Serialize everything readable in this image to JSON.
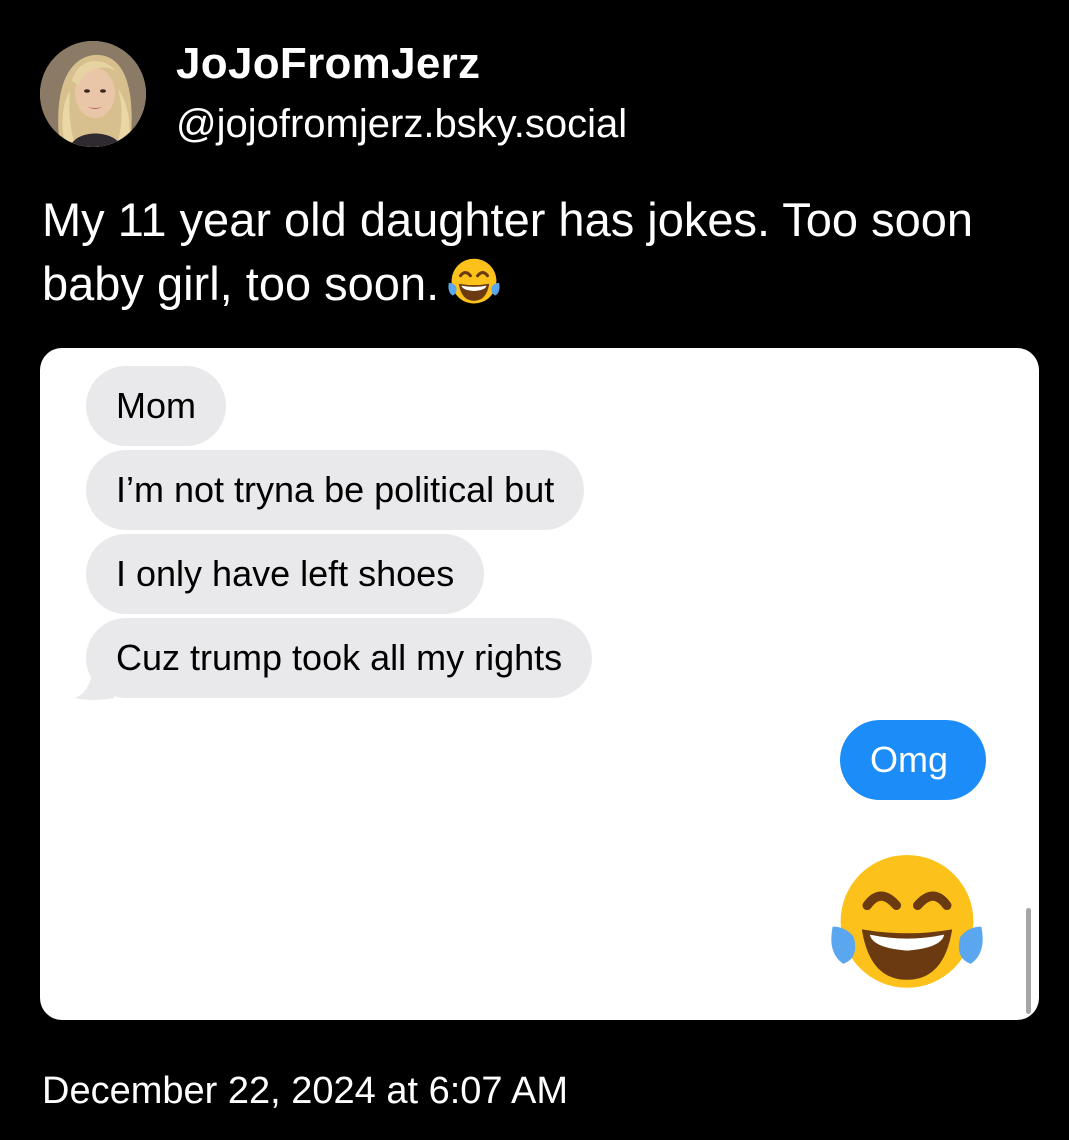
{
  "author": {
    "display_name": "JoJoFromJerz",
    "handle": "@jojofromjerz.bsky.social"
  },
  "post": {
    "text": "My 11 year old daughter has jokes. Too soon baby girl, too soon.",
    "text_emoji": "face-with-tears-of-joy-icon",
    "timestamp": "December 22, 2024 at 6:07 AM"
  },
  "attached_screenshot": {
    "received_messages": [
      "Mom",
      "I’m not tryna be political but",
      "I only have left shoes",
      "Cuz trump took all my rights"
    ],
    "sent_messages": [
      "Omg"
    ],
    "sent_emoji": "face-with-tears-of-joy-icon",
    "colors": {
      "received_bubble": "#e9e9eb",
      "sent_bubble": "#1b8cf8"
    }
  }
}
